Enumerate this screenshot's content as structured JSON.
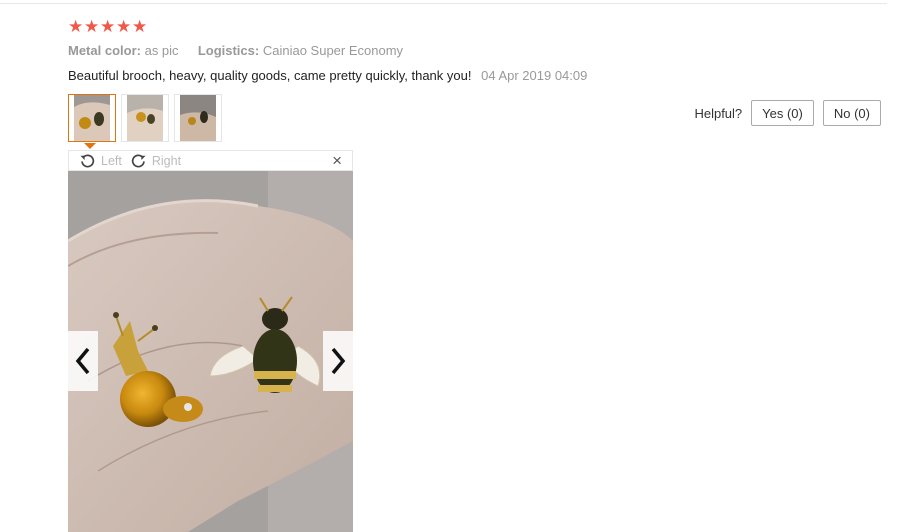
{
  "rating": {
    "stars": 5,
    "max": 5,
    "color": "#f1584a"
  },
  "attributes": {
    "metal_label": "Metal color:",
    "metal_value": "as pic",
    "logistics_label": "Logistics:",
    "logistics_value": "Cainiao Super Economy"
  },
  "review": {
    "text": "Beautiful brooch, heavy, quality goods, came pretty quickly, thank you!",
    "date": "04 Apr 2019 04:09"
  },
  "helpful": {
    "label": "Helpful?",
    "yes": "Yes (0)",
    "no": "No (0)"
  },
  "viewer": {
    "rotate_left": "Left",
    "rotate_right": "Right",
    "close_glyph": "×",
    "prev_icon": "chevron-left-icon",
    "next_icon": "chevron-right-icon"
  },
  "colors": {
    "accent": "#e0750f",
    "star": "#f1584a",
    "muted": "#999999"
  }
}
